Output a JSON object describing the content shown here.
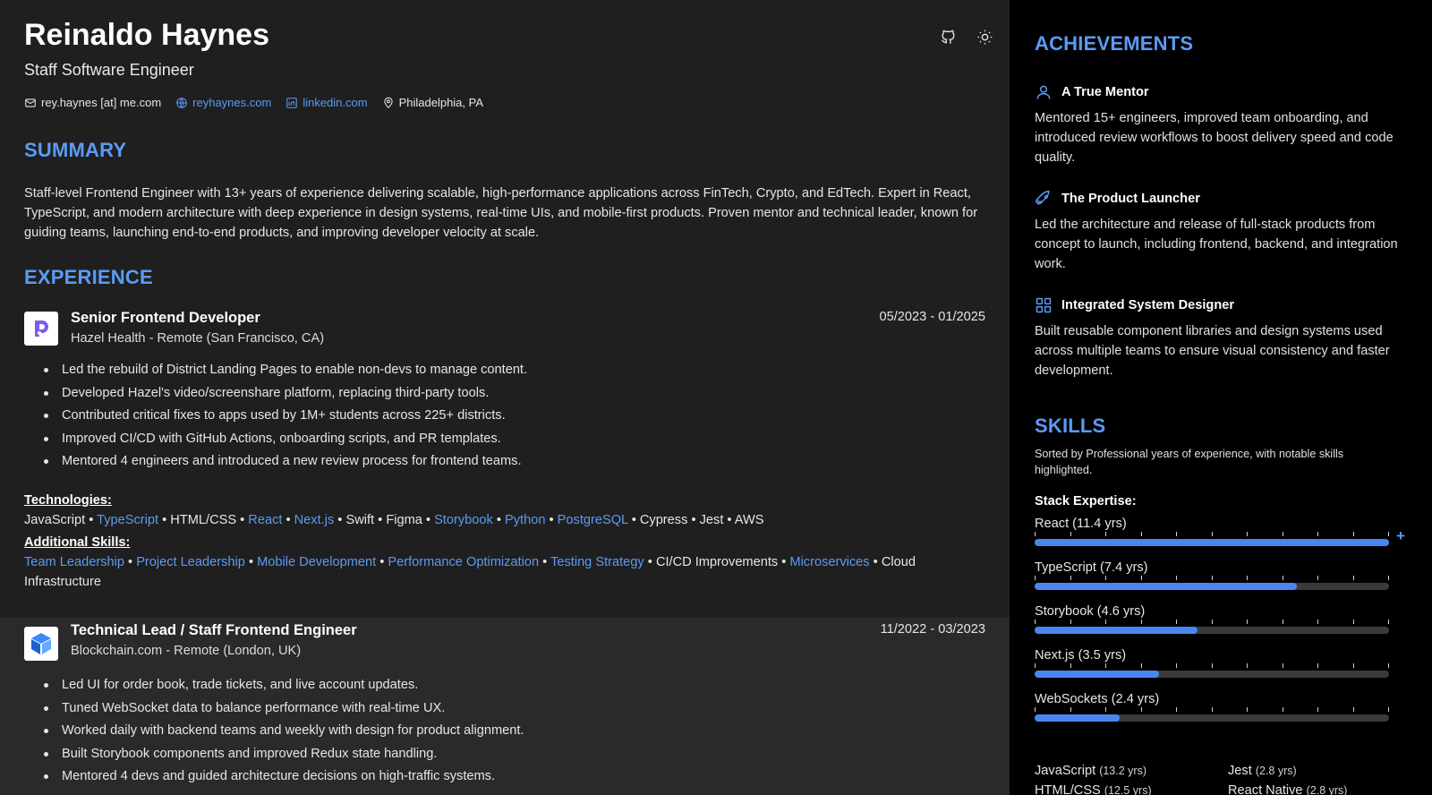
{
  "header": {
    "name": "Reinaldo Haynes",
    "role": "Staff Software Engineer",
    "email": "rey.haynes [at] me.com",
    "website": "reyhaynes.com",
    "linkedin": "linkedin.com",
    "location": "Philadelphia, PA",
    "icons": [
      "github-icon",
      "sun-icon"
    ]
  },
  "summary": {
    "title": "SUMMARY",
    "text": "Staff-level Frontend Engineer with 13+ years of experience delivering scalable, high-performance applications across FinTech, Crypto, and EdTech. Expert in React, TypeScript, and modern architecture with deep experience in design systems, real-time UIs, and mobile-first products. Proven mentor and technical leader, known for guiding teams, launching end-to-end products, and improving developer velocity at scale."
  },
  "experience": {
    "title": "EXPERIENCE",
    "jobs": [
      {
        "title": "Senior Frontend Developer",
        "company": "Hazel Health - Remote (San Francisco, CA)",
        "dates": "05/2023 - 01/2025",
        "bullets": [
          "Led the rebuild of District Landing Pages to enable non-devs to manage content.",
          "Developed Hazel's video/screenshare platform, replacing third-party tools.",
          "Contributed critical fixes to apps used by 1M+ students across 225+ districts.",
          "Improved CI/CD with GitHub Actions, onboarding scripts, and PR templates.",
          "Mentored 4 engineers and introduced a new review process for frontend teams."
        ],
        "technologies_label": "Technologies:",
        "technologies": [
          {
            "t": "JavaScript",
            "h": false
          },
          {
            "t": "TypeScript",
            "h": true
          },
          {
            "t": "HTML/CSS",
            "h": false
          },
          {
            "t": "React",
            "h": true
          },
          {
            "t": "Next.js",
            "h": true
          },
          {
            "t": "Swift",
            "h": false
          },
          {
            "t": "Figma",
            "h": false
          },
          {
            "t": "Storybook",
            "h": true
          },
          {
            "t": "Python",
            "h": true
          },
          {
            "t": "PostgreSQL",
            "h": true
          },
          {
            "t": "Cypress",
            "h": false
          },
          {
            "t": "Jest",
            "h": false
          },
          {
            "t": "AWS",
            "h": false
          }
        ],
        "additional_label": "Additional Skills:",
        "additional": [
          {
            "t": "Team Leadership",
            "h": true
          },
          {
            "t": "Project Leadership",
            "h": true
          },
          {
            "t": "Mobile Development",
            "h": true
          },
          {
            "t": "Performance Optimization",
            "h": true
          },
          {
            "t": "Testing Strategy",
            "h": true
          },
          {
            "t": "CI/CD Improvements",
            "h": false
          },
          {
            "t": "Microservices",
            "h": true
          },
          {
            "t": "Cloud Infrastructure",
            "h": false
          }
        ]
      },
      {
        "title": "Technical Lead / Staff Frontend Engineer",
        "company": "Blockchain.com - Remote (London, UK)",
        "dates": "11/2022 - 03/2023",
        "bullets": [
          "Led UI for order book, trade tickets, and live account updates.",
          "Tuned WebSocket data to balance performance with real-time UX.",
          "Worked daily with backend teams and weekly with design for product alignment.",
          "Built Storybook components and improved Redux state handling.",
          "Mentored 4 devs and guided architecture decisions on high-traffic systems."
        ]
      }
    ]
  },
  "achievements": {
    "title": "ACHIEVEMENTS",
    "items": [
      {
        "title": "A True Mentor",
        "icon": "user-icon",
        "text": "Mentored 15+ engineers, improved team onboarding, and introduced review workflows to boost delivery speed and code quality."
      },
      {
        "title": "The Product Launcher",
        "icon": "rocket-icon",
        "text": "Led the architecture and release of full-stack products from concept to launch, including frontend, backend, and integration work."
      },
      {
        "title": "Integrated System Designer",
        "icon": "grid-icon",
        "text": "Built reusable component libraries and design systems used across multiple teams to ensure visual consistency and faster development."
      }
    ]
  },
  "skills": {
    "title": "SKILLS",
    "note": "Sorted by Professional years of experience, with notable skills highlighted.",
    "stack_label": "Stack Expertise:",
    "stack": [
      {
        "label": "React (11.4 yrs)",
        "fill": 1.0
      },
      {
        "label": "TypeScript (7.4 yrs)",
        "fill": 0.74
      },
      {
        "label": "Storybook (4.6 yrs)",
        "fill": 0.46
      },
      {
        "label": "Next.js (3.5 yrs)",
        "fill": 0.35
      },
      {
        "label": "WebSockets (2.4 yrs)",
        "fill": 0.24
      }
    ],
    "other": [
      {
        "name": "JavaScript",
        "years": "(13.2 yrs)"
      },
      {
        "name": "Jest",
        "years": "(2.8 yrs)"
      },
      {
        "name": "HTML/CSS",
        "years": "(12.5 yrs)"
      },
      {
        "name": "React Native",
        "years": "(2.8 yrs)"
      }
    ]
  },
  "colors": {
    "accent": "#5b9bf5",
    "bar": "#4a86f0",
    "sidebar_bg": "#000000",
    "main_bg": "#1f1f1f"
  }
}
